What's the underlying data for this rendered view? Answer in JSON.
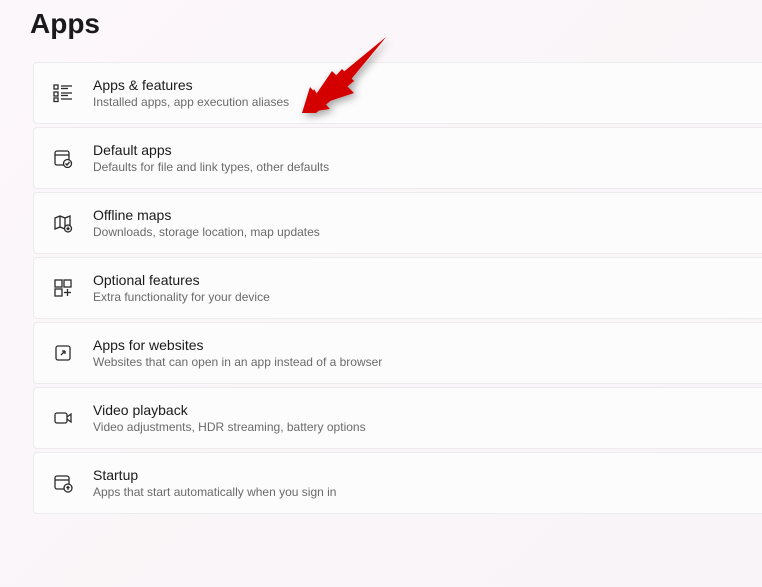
{
  "page_title": "Apps",
  "items": [
    {
      "title": "Apps & features",
      "subtitle": "Installed apps, app execution aliases",
      "icon": "apps-features-icon"
    },
    {
      "title": "Default apps",
      "subtitle": "Defaults for file and link types, other defaults",
      "icon": "default-apps-icon"
    },
    {
      "title": "Offline maps",
      "subtitle": "Downloads, storage location, map updates",
      "icon": "offline-maps-icon"
    },
    {
      "title": "Optional features",
      "subtitle": "Extra functionality for your device",
      "icon": "optional-features-icon"
    },
    {
      "title": "Apps for websites",
      "subtitle": "Websites that can open in an app instead of a browser",
      "icon": "apps-websites-icon"
    },
    {
      "title": "Video playback",
      "subtitle": "Video adjustments, HDR streaming, battery options",
      "icon": "video-playback-icon"
    },
    {
      "title": "Startup",
      "subtitle": "Apps that start automatically when you sign in",
      "icon": "startup-icon"
    }
  ],
  "arrow_color": "#d40000"
}
